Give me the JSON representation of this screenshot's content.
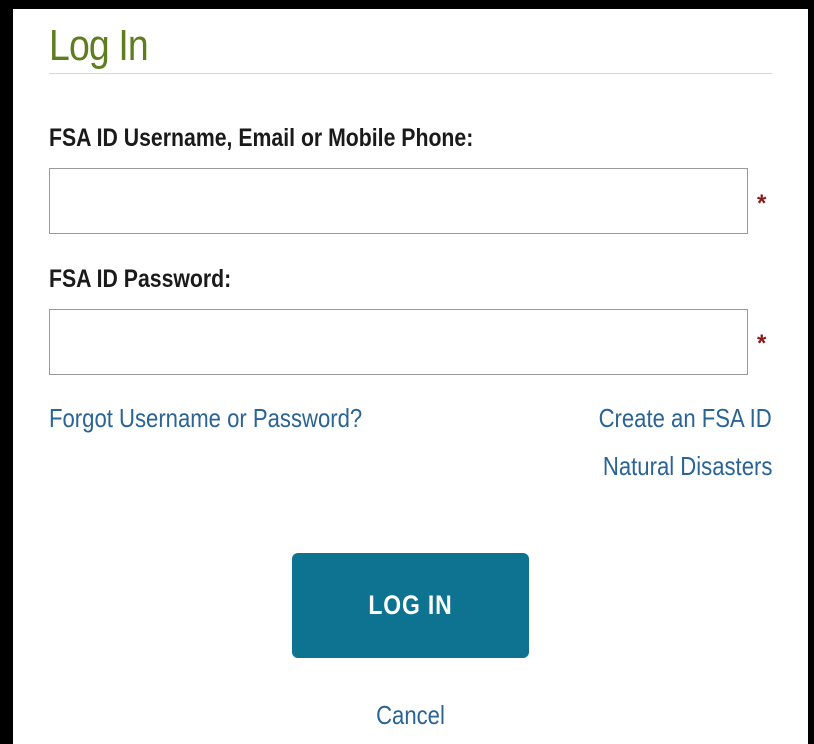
{
  "login": {
    "title": "Log In",
    "username_label": "FSA ID Username, Email or Mobile Phone:",
    "username_value": "",
    "password_label": "FSA ID Password:",
    "password_value": "",
    "required_marker": "*",
    "forgot_link": "Forgot Username or Password?",
    "create_link": "Create an FSA ID",
    "disasters_link": "Natural Disasters",
    "submit_label": "LOG IN",
    "cancel_link": "Cancel"
  },
  "colors": {
    "title": "#5f7d1e",
    "link": "#2a6496",
    "button": "#0e7291",
    "required": "#8b1a1a"
  }
}
